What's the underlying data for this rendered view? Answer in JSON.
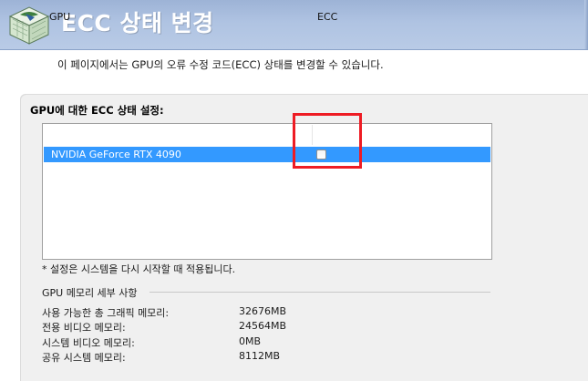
{
  "header": {
    "title": "ECC 상태 변경",
    "icon": "control-panel-icon"
  },
  "description": "이 페이지에서는 GPU의 오류 수정 코드(ECC) 상태를 변경할 수 있습니다.",
  "panel": {
    "title": "GPU에 대한 ECC 상태 설정:",
    "table": {
      "columns": [
        "GPU",
        "ECC"
      ],
      "rows": [
        {
          "gpu": "NVIDIA GeForce RTX 4090",
          "ecc_checked": false,
          "selected": true
        }
      ]
    },
    "note": "* 설정은 시스템을 다시 시작할 때 적용됩니다.",
    "memory": {
      "title": "GPU 메모리 세부 사항",
      "items": [
        {
          "label": "사용 가능한 총 그래픽 메모리:",
          "value": "32676MB"
        },
        {
          "label": "전용 비디오 메모리:",
          "value": "24564MB"
        },
        {
          "label": "시스템 비디오 메모리:",
          "value": "0MB"
        },
        {
          "label": "공유 시스템 메모리:",
          "value": "8112MB"
        }
      ]
    }
  },
  "colors": {
    "header_bg": "#afc3e2",
    "selection": "#3399ff",
    "highlight": "#ee1c24",
    "panel_bg": "#f0f0f0"
  }
}
